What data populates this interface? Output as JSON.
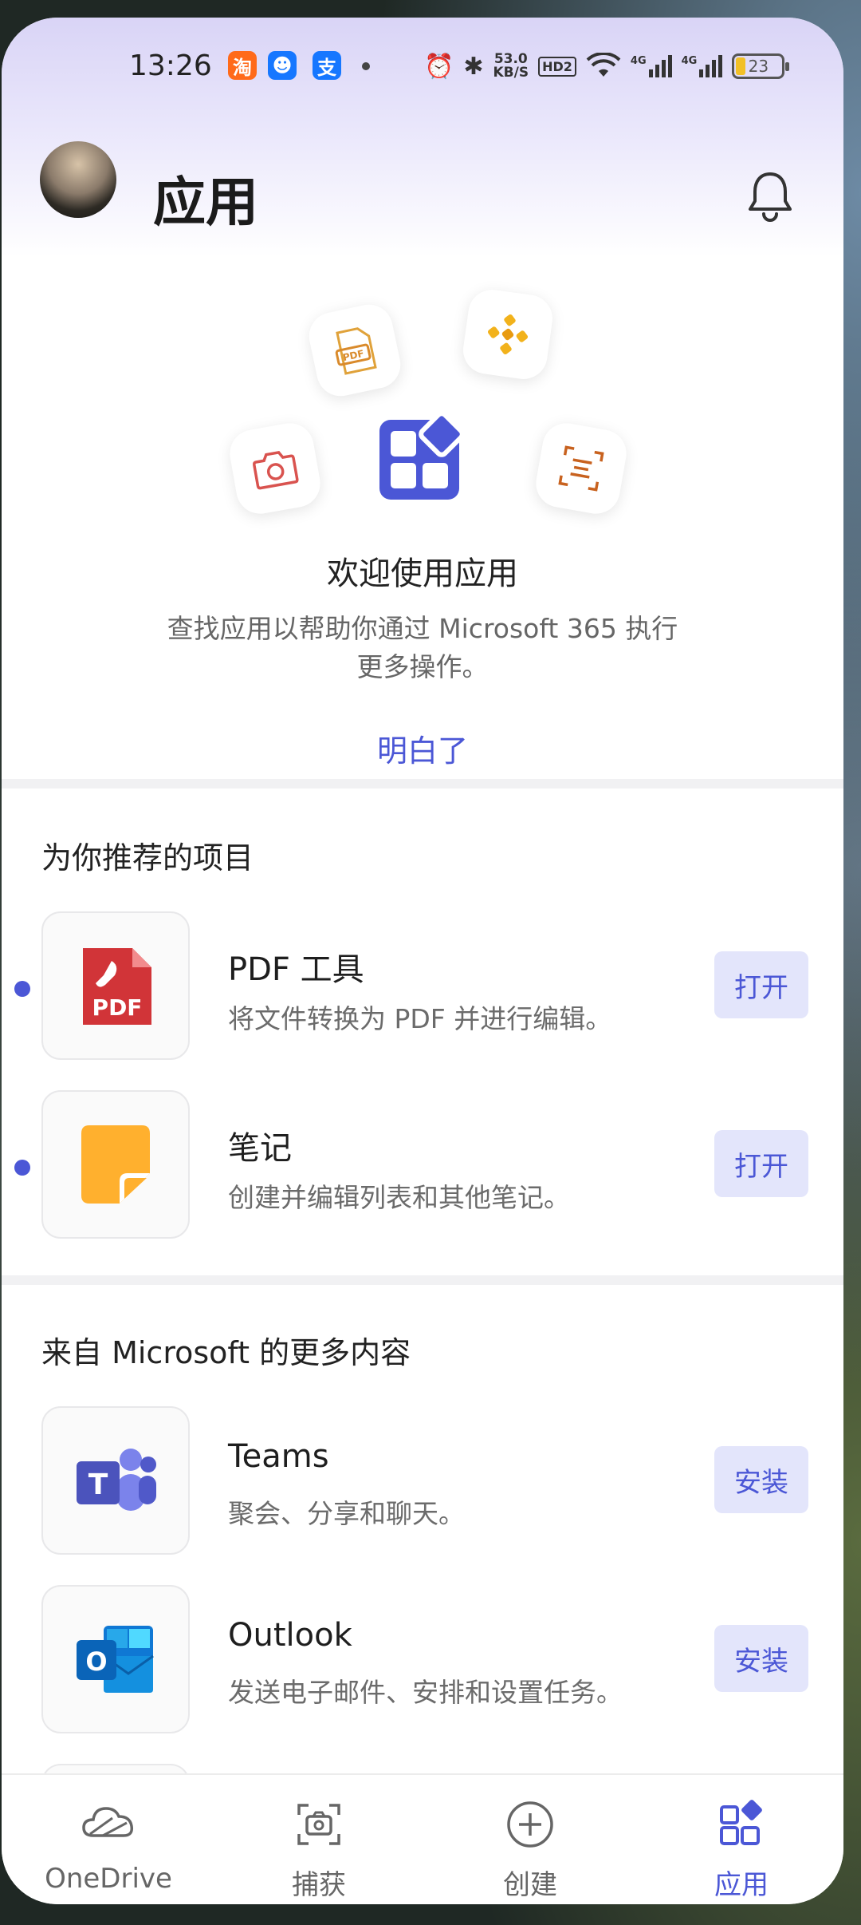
{
  "status_bar": {
    "time": "13:26",
    "apps": [
      {
        "name": "taobao-icon",
        "glyph": "淘",
        "color": "#ff6a1a"
      },
      {
        "name": "qq-icon",
        "glyph": "☻",
        "color": "#1677ff"
      },
      {
        "name": "alipay-icon",
        "glyph": "支",
        "color": "#1677ff"
      }
    ],
    "net_speed_value": "53.0",
    "net_speed_unit": "KB/S",
    "hd_label": "HD2",
    "network_1": "4G",
    "network_2": "4G",
    "battery": "23"
  },
  "header": {
    "title": "应用"
  },
  "welcome": {
    "title": "欢迎使用应用",
    "description": "查找应用以帮助你通过 Microsoft 365 执行更多操作。",
    "dismiss_label": "明白了"
  },
  "recommended": {
    "title": "为你推荐的项目",
    "items": [
      {
        "name": "PDF 工具",
        "description": "将文件转换为 PDF 并进行编辑。",
        "action": "打开",
        "icon": "pdf-icon",
        "icon_text": "PDF"
      },
      {
        "name": "笔记",
        "description": "创建并编辑列表和其他笔记。",
        "action": "打开",
        "icon": "sticky-note-icon"
      }
    ]
  },
  "more": {
    "title": "来自 Microsoft 的更多内容",
    "items": [
      {
        "name": "Teams",
        "description": "聚会、分享和聊天。",
        "action": "安装",
        "icon": "teams-icon",
        "icon_text": "T"
      },
      {
        "name": "Outlook",
        "description": "发送电子邮件、安排和设置任务。",
        "action": "安装",
        "icon": "outlook-icon",
        "icon_text": "O"
      }
    ]
  },
  "bottom_nav": [
    {
      "label": "OneDrive",
      "icon": "cloud-icon",
      "active": false
    },
    {
      "label": "捕获",
      "icon": "camera-capture-icon",
      "active": false
    },
    {
      "label": "创建",
      "icon": "plus-circle-icon",
      "active": false
    },
    {
      "label": "应用",
      "icon": "apps-icon",
      "active": true
    }
  ],
  "colors": {
    "accent": "#4b57d6",
    "action_bg": "#e3e5fb",
    "pdf_red": "#d13438",
    "note_yellow": "#ffb02e",
    "teams_purple": "#5059c9",
    "outlook_blue": "#0f78d4"
  }
}
